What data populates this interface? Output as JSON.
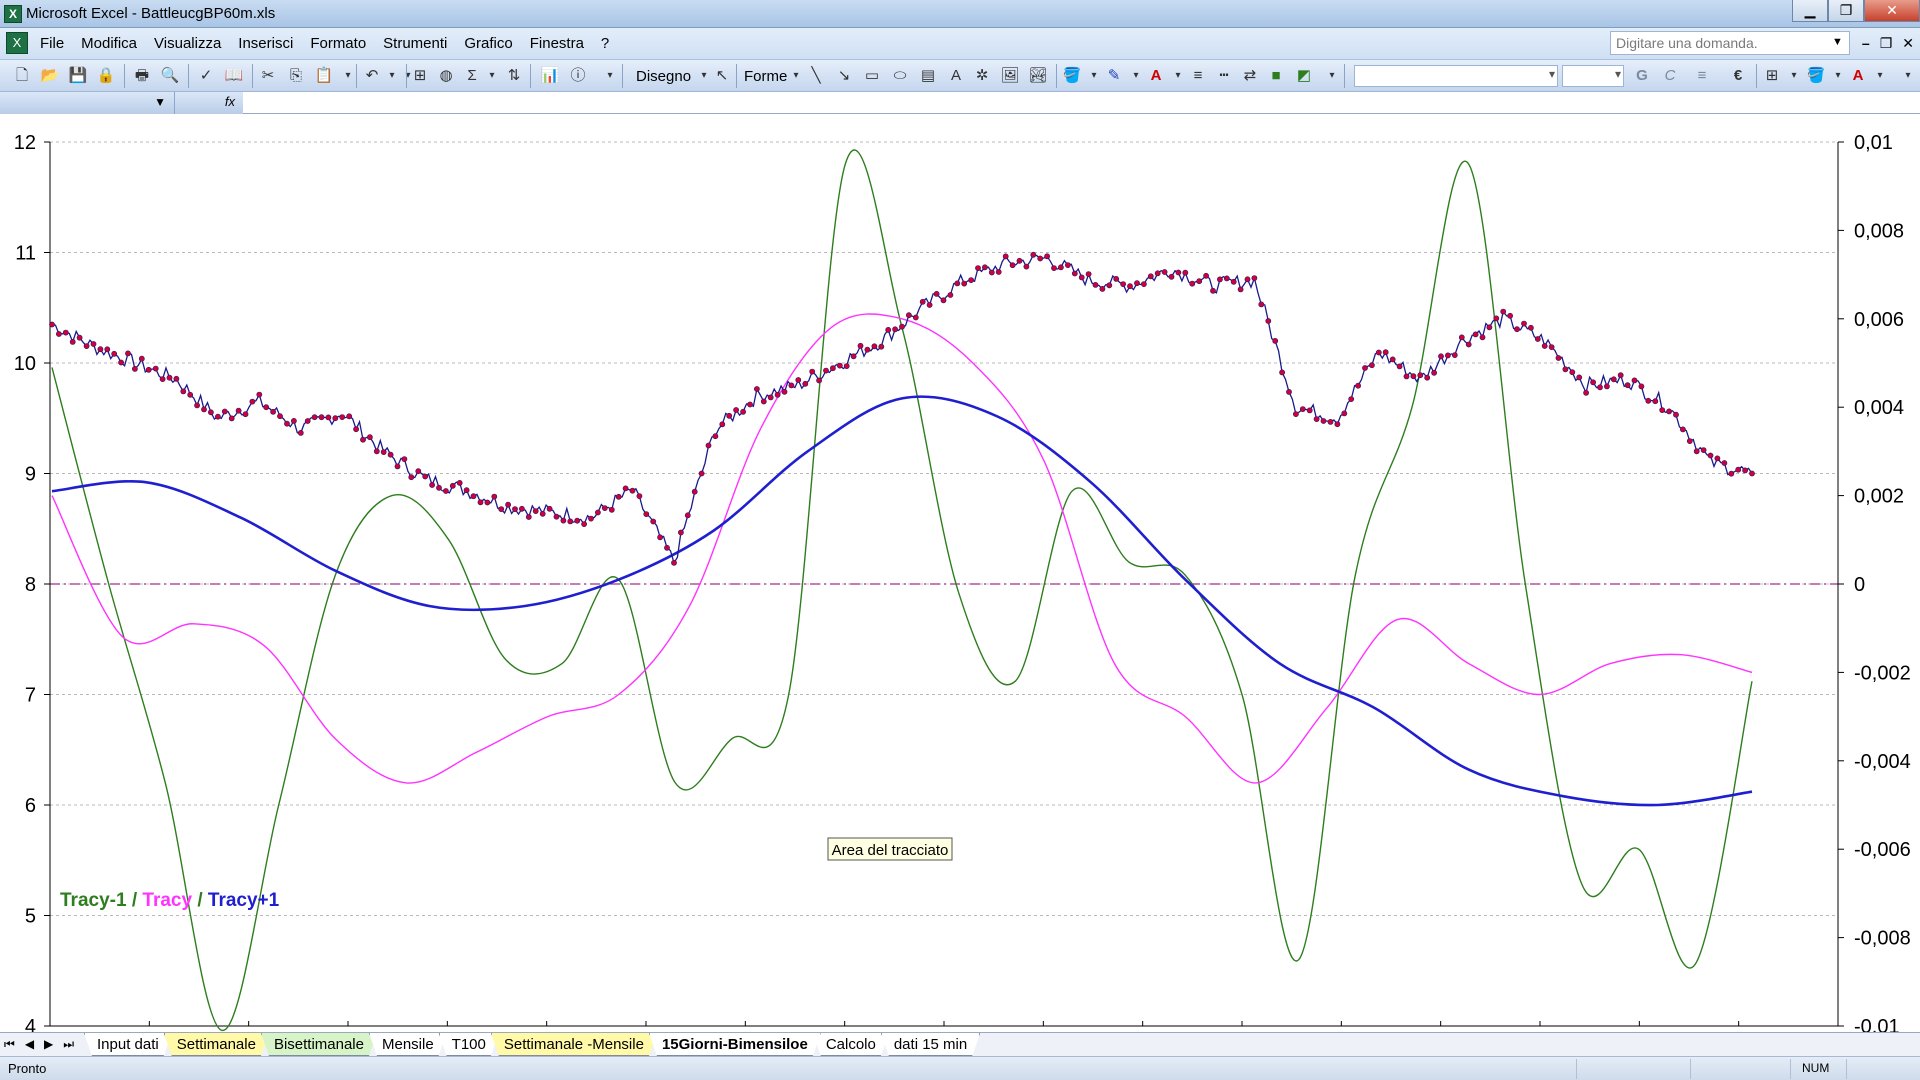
{
  "window": {
    "title": "Microsoft Excel - BattleucgBP60m.xls",
    "buttons": {
      "minimize": "▁",
      "restore": "❐",
      "close": "✕"
    }
  },
  "menubar": {
    "items": [
      "File",
      "Modifica",
      "Visualizza",
      "Inserisci",
      "Formato",
      "Strumenti",
      "Grafico",
      "Finestra",
      "?"
    ],
    "ask_placeholder": "Digitare una domanda."
  },
  "toolbar": {
    "disegno_label": "Disegno",
    "forme_label": "Forme"
  },
  "chart_data": {
    "type": "line",
    "left_axis": {
      "ylim": [
        4,
        12
      ],
      "ticks": [
        "12",
        "11",
        "10",
        "9",
        "8",
        "7",
        "6",
        "5",
        "4"
      ]
    },
    "right_axis": {
      "ylim": [
        -0.01,
        0.01
      ],
      "ticks": [
        "0,01",
        "0,008",
        "0,006",
        "0,004",
        "0,002",
        "0",
        "-0,002",
        "-0,004",
        "-0,006",
        "-0,008",
        "-0,01"
      ]
    },
    "grid": true,
    "zero_line_right_axis": 0,
    "tooltip": "Area del tracciato",
    "legend": {
      "position": "bottom-left",
      "entries": [
        {
          "text": "Tracy-1",
          "color": "#2e7d1e"
        },
        {
          "text": " / ",
          "color": "#2e7d1e"
        },
        {
          "text": "Tracy",
          "color": "#ff33ff"
        },
        {
          "text": " / ",
          "color": "#2e7d1e"
        },
        {
          "text": "Tracy+1",
          "color": "#1f1fd0"
        }
      ]
    },
    "x_categories": 18,
    "x": [
      0,
      5,
      10,
      15,
      20,
      25,
      30,
      35,
      40,
      45,
      50,
      55,
      60,
      65,
      70,
      75,
      80,
      85,
      90,
      95,
      100
    ],
    "price_series": {
      "name": "Prezzo",
      "axis": "left",
      "color": "#d0003a",
      "values": [
        10.35,
        10.15,
        10.0,
        9.85,
        9.5,
        9.65,
        9.4,
        9.55,
        9.2,
        8.95,
        8.85,
        8.7,
        8.65,
        8.6,
        8.85,
        8.2,
        9.4,
        9.7,
        9.8,
        10.0,
        10.2,
        10.5,
        10.75,
        10.9,
        10.95,
        10.75,
        10.7,
        10.85,
        10.7,
        10.75,
        9.6,
        9.5,
        10.1,
        9.85,
        10.2,
        10.4,
        10.2,
        9.8,
        9.85,
        9.6,
        9.1,
        9.0
      ]
    },
    "series": [
      {
        "name": "Tracy-1",
        "axis": "right",
        "color": "#2e7d1e",
        "values": [
          0.0049,
          0.0,
          -0.0045,
          -0.0101,
          -0.005,
          0.0002,
          0.002,
          0.001,
          -0.0017,
          -0.0018,
          0.0001,
          -0.0045,
          -0.0035,
          -0.0025,
          0.0095,
          0.0058,
          -0.0002,
          -0.0022,
          0.0021,
          0.0005,
          0.0002,
          -0.0025,
          -0.0085,
          0.0002,
          0.004,
          0.0095,
          0.0,
          -0.0068,
          -0.006,
          -0.0086,
          -0.0022
        ]
      },
      {
        "name": "Tracy",
        "axis": "right",
        "color": "#ff33ff",
        "values": [
          0.002,
          -0.0012,
          -0.0009,
          -0.0014,
          -0.0035,
          -0.0045,
          -0.0038,
          -0.003,
          -0.0025,
          -0.0005,
          0.0035,
          0.0058,
          0.006,
          0.005,
          0.0028,
          -0.0018,
          -0.003,
          -0.0045,
          -0.0028,
          -0.0008,
          -0.0018,
          -0.0025,
          -0.0018,
          -0.0016,
          -0.002
        ]
      },
      {
        "name": "Tracy+1",
        "axis": "right",
        "color": "#1f1fd0",
        "values": [
          0.0021,
          0.0023,
          0.0015,
          0.0003,
          -0.0005,
          -0.0005,
          0.0001,
          0.0012,
          0.003,
          0.0042,
          0.0038,
          0.0023,
          0.0001,
          -0.0018,
          -0.0028,
          -0.0042,
          -0.0048,
          -0.005,
          -0.0047
        ]
      }
    ]
  },
  "sheet_tabs": {
    "nav": [
      "⏮",
      "◀",
      "▶",
      "⏭"
    ],
    "items": [
      {
        "label": "Input dati",
        "style": "plain"
      },
      {
        "label": "Settimanale",
        "style": "yellow"
      },
      {
        "label": "Bisettimanale",
        "style": "green"
      },
      {
        "label": "Mensile",
        "style": "plain"
      },
      {
        "label": "T100",
        "style": "plain"
      },
      {
        "label": "Settimanale -Mensile",
        "style": "yellow"
      },
      {
        "label": "15Giorni-Bimensiloe",
        "style": "active"
      },
      {
        "label": "Calcolo",
        "style": "plain"
      },
      {
        "label": "dati 15 min",
        "style": "plain"
      }
    ]
  },
  "status": {
    "text": "Pronto",
    "num": "NUM"
  }
}
